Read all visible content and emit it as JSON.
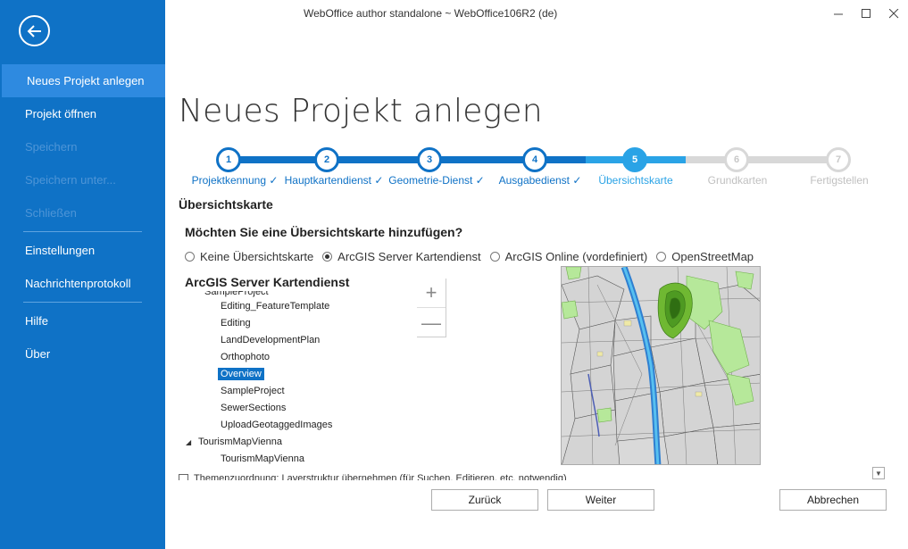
{
  "window": {
    "title": "WebOffice author standalone ~ WebOffice106R2 (de)",
    "controls": [
      "minimize-icon",
      "maximize-icon",
      "close-icon"
    ]
  },
  "sidebar": {
    "back_icon": "arrow-left-circle-icon",
    "items": [
      {
        "label": "Neues Projekt anlegen",
        "state": "active"
      },
      {
        "label": "Projekt öffnen",
        "state": "enabled"
      },
      {
        "label": "Speichern",
        "state": "disabled"
      },
      {
        "label": "Speichern unter...",
        "state": "disabled"
      },
      {
        "label": "Schließen",
        "state": "disabled"
      },
      {
        "label": "Einstellungen",
        "state": "enabled"
      },
      {
        "label": "Nachrichtenprotokoll",
        "state": "enabled"
      },
      {
        "label": "Hilfe",
        "state": "enabled"
      },
      {
        "label": "Über",
        "state": "enabled"
      }
    ]
  },
  "main": {
    "title": "Neues Projekt anlegen",
    "steps": [
      {
        "number": "1",
        "label": "Projektkennung ✓",
        "state": "done"
      },
      {
        "number": "2",
        "label": "Hauptkartendienst ✓",
        "state": "done"
      },
      {
        "number": "3",
        "label": "Geometrie-Dienst ✓",
        "state": "done"
      },
      {
        "number": "4",
        "label": "Ausgabedienst ✓",
        "state": "done"
      },
      {
        "number": "5",
        "label": "Übersichtskarte",
        "state": "current"
      },
      {
        "number": "6",
        "label": "Grundkarten",
        "state": "future"
      },
      {
        "number": "7",
        "label": "Fertigstellen",
        "state": "future"
      }
    ],
    "section_title": "Übersichtskarte",
    "question": "Möchten Sie eine Übersichtskarte hinzufügen?",
    "options": [
      {
        "label": "Keine Übersichtskarte",
        "checked": false
      },
      {
        "label": "ArcGIS Server Kartendienst",
        "checked": true
      },
      {
        "label": "ArcGIS Online (vordefiniert)",
        "checked": false
      },
      {
        "label": "OpenStreetMap",
        "checked": false
      }
    ],
    "tree_title": "ArcGIS Server Kartendienst",
    "tree": {
      "cut_top_label": "SampleProject",
      "items": [
        {
          "label": "Editing_FeatureTemplate",
          "type": "leaf",
          "selected": false
        },
        {
          "label": "Editing",
          "type": "leaf",
          "selected": false
        },
        {
          "label": "LandDevelopmentPlan",
          "type": "leaf",
          "selected": false
        },
        {
          "label": "Orthophoto",
          "type": "leaf",
          "selected": false
        },
        {
          "label": "Overview",
          "type": "leaf",
          "selected": true
        },
        {
          "label": "SampleProject",
          "type": "leaf",
          "selected": false
        },
        {
          "label": "SewerSections",
          "type": "leaf",
          "selected": false
        },
        {
          "label": "UploadGeotaggedImages",
          "type": "leaf",
          "selected": false
        },
        {
          "label": "TourismMapVienna",
          "type": "parent",
          "selected": false
        },
        {
          "label": "TourismMapVienna",
          "type": "leaf",
          "selected": false
        }
      ]
    },
    "zoom": {
      "in": "+",
      "out": "—"
    },
    "bottom_checkbox_label": "Themenzuordnung: Layerstruktur übernehmen (für Suchen, Editieren, etc. notwendig)",
    "scroll_down_icon": "▼"
  },
  "buttons": {
    "back": "Zurück",
    "next": "Weiter",
    "cancel": "Abbrechen"
  },
  "colors": {
    "sidebar": "#0f72c6",
    "sidebar_active": "#2e8ae0",
    "step_done": "#0f72c6",
    "step_current": "#2aa3e6",
    "step_future": "#d8d8d8"
  }
}
